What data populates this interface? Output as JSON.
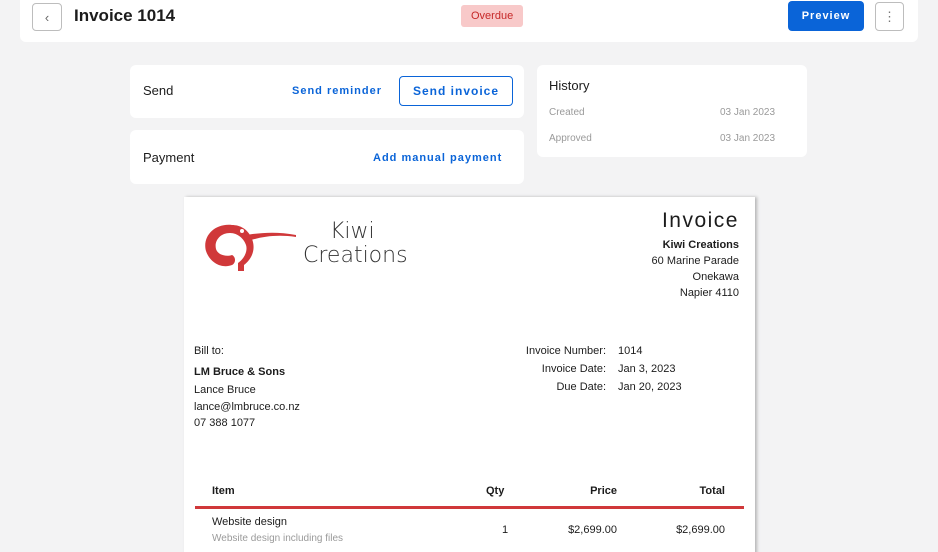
{
  "header": {
    "back_icon": "chevron-left-icon",
    "title": "Invoice 1014",
    "status_badge": "Overdue",
    "status_color": "#c62828",
    "preview_label": "Preview",
    "more_icon": "more-vertical-icon",
    "accent": "#0a64d8"
  },
  "send_card": {
    "title": "Send",
    "send_reminder_label": "Send reminder",
    "send_invoice_label": "Send invoice"
  },
  "payment_card": {
    "title": "Payment",
    "add_payment_label": "Add manual payment"
  },
  "history": {
    "title": "History",
    "entries": [
      {
        "label": "Created",
        "date": "03 Jan 2023"
      },
      {
        "label": "Approved",
        "date": "03 Jan 2023"
      }
    ]
  },
  "invoice": {
    "heading": "Invoice",
    "brand_color": "#d0383a",
    "logo_line1": "Kiwi",
    "logo_line2": "Creations",
    "company": {
      "name": "Kiwi Creations",
      "street": "60 Marine Parade",
      "suburb": "Onekawa",
      "city": "Napier 4110"
    },
    "bill_to": {
      "label": "Bill to:",
      "name": "LM Bruce & Sons",
      "contact": "Lance Bruce",
      "email": "lance@lmbruce.co.nz",
      "phone": "07 388 1077"
    },
    "meta": [
      {
        "label": "Invoice Number:",
        "value": "1014"
      },
      {
        "label": "Invoice Date:",
        "value": "Jan 3, 2023"
      },
      {
        "label": "Due Date:",
        "value": "Jan 20, 2023"
      }
    ],
    "columns": {
      "item": "Item",
      "qty": "Qty",
      "price": "Price",
      "total": "Total"
    },
    "line_items": [
      {
        "name": "Website design",
        "description": "Website design including files",
        "qty": "1",
        "price": "$2,699.00",
        "total": "$2,699.00"
      }
    ]
  }
}
